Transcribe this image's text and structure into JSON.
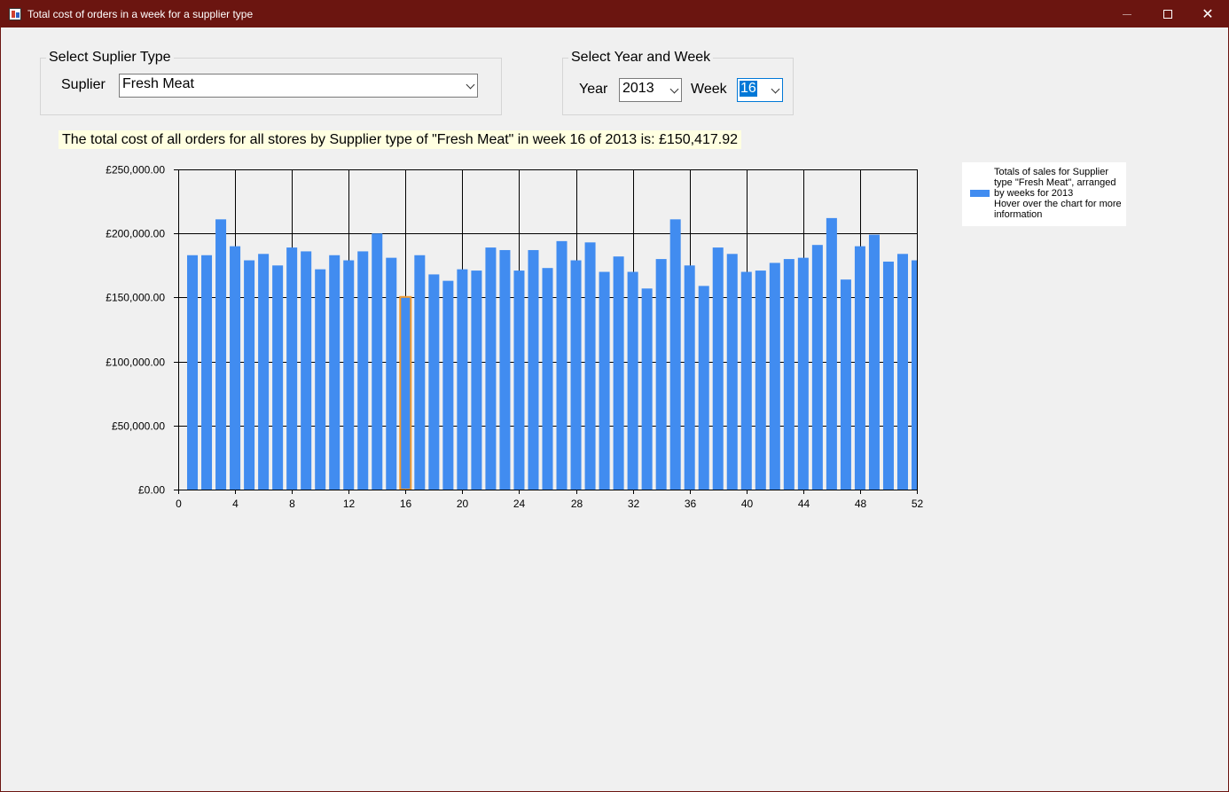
{
  "window": {
    "title": "Total cost of orders in a week for a supplier type",
    "controls": {
      "minimize": "—",
      "close": "✕"
    }
  },
  "supplier_group": {
    "legend": "Select Suplier Type",
    "label": "Suplier",
    "selected": "Fresh Meat"
  },
  "yearweek_group": {
    "legend": "Select Year and Week",
    "year_label": "Year",
    "year_selected": "2013",
    "week_label": "Week",
    "week_selected": "16"
  },
  "summary_text": "The total cost of all orders for all stores by Supplier type of \"Fresh Meat\" in week 16 of 2013 is: £150,417.92",
  "legend": {
    "series_text": "Totals of sales for Supplier type \"Fresh Meat\", arranged by weeks for 2013",
    "hint_text": "Hover over the chart for more information"
  },
  "colors": {
    "titlebar": "#6b1510",
    "bar": "#418cf0",
    "highlight": "#f09a30"
  },
  "chart_data": {
    "type": "bar",
    "x": [
      1,
      2,
      3,
      4,
      5,
      6,
      7,
      8,
      9,
      10,
      11,
      12,
      13,
      14,
      15,
      16,
      17,
      18,
      19,
      20,
      21,
      22,
      23,
      24,
      25,
      26,
      27,
      28,
      29,
      30,
      31,
      32,
      33,
      34,
      35,
      36,
      37,
      38,
      39,
      40,
      41,
      42,
      43,
      44,
      45,
      46,
      47,
      48,
      49,
      50,
      51,
      52
    ],
    "values": [
      183000,
      183000,
      211000,
      190000,
      179000,
      184000,
      175000,
      189000,
      186000,
      172000,
      183000,
      179000,
      186000,
      200000,
      181000,
      150417.92,
      183000,
      168000,
      163000,
      172000,
      171000,
      189000,
      187000,
      171000,
      187000,
      173000,
      194000,
      179000,
      193000,
      170000,
      182000,
      170000,
      157000,
      180000,
      211000,
      175000,
      159000,
      189000,
      184000,
      170000,
      171000,
      177000,
      180000,
      181000,
      191000,
      212000,
      164000,
      190000,
      199000,
      178000,
      184000,
      179000
    ],
    "highlighted_x": 16,
    "xlim": [
      0,
      52
    ],
    "ylim": [
      0,
      250000
    ],
    "x_ticks": [
      0,
      4,
      8,
      12,
      16,
      20,
      24,
      28,
      32,
      36,
      40,
      44,
      48,
      52
    ],
    "y_ticks": [
      0,
      50000,
      100000,
      150000,
      200000,
      250000
    ],
    "y_tick_labels": [
      "£0.00",
      "£50,000.00",
      "£100,000.00",
      "£150,000.00",
      "£200,000.00",
      "£250,000.00"
    ],
    "grid": true,
    "legend_position": "right"
  }
}
